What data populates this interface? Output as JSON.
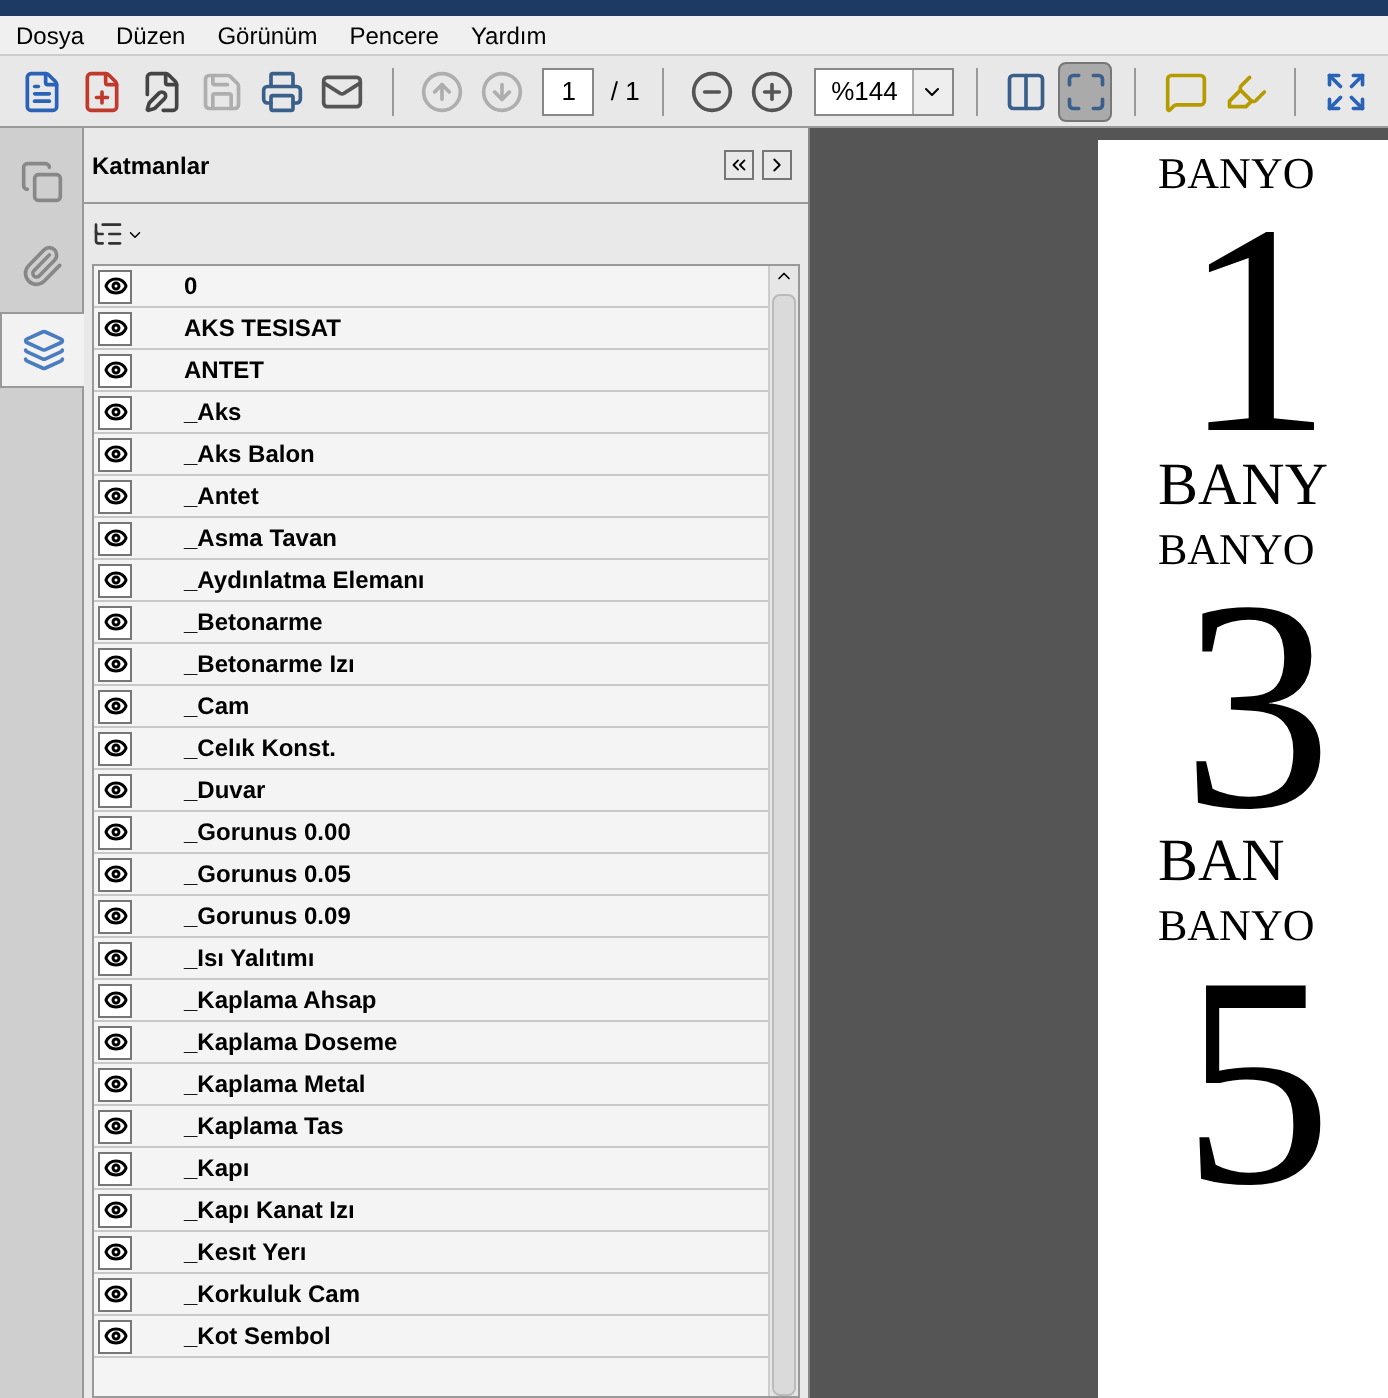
{
  "menu": [
    "Dosya",
    "Düzen",
    "Görünüm",
    "Pencere",
    "Yardım"
  ],
  "tools": [
    {
      "kind": "create",
      "disabled": false
    },
    {
      "kind": "new-doc",
      "disabled": false
    },
    {
      "kind": "sign",
      "disabled": false
    },
    {
      "kind": "save",
      "disabled": true
    },
    {
      "kind": "print",
      "disabled": false
    },
    {
      "kind": "mail",
      "disabled": false
    },
    {
      "kind": "sep"
    },
    {
      "kind": "prev",
      "disabled": true
    },
    {
      "kind": "next",
      "disabled": true
    },
    {
      "kind": "page"
    },
    {
      "kind": "sep"
    },
    {
      "kind": "zoom-out",
      "disabled": false
    },
    {
      "kind": "zoom-in",
      "disabled": false
    },
    {
      "kind": "zoom"
    },
    {
      "kind": "sep"
    },
    {
      "kind": "fit-width",
      "selected": false
    },
    {
      "kind": "fit-page",
      "selected": true
    },
    {
      "kind": "sep"
    },
    {
      "kind": "comment",
      "disabled": false
    },
    {
      "kind": "highlight",
      "disabled": false
    },
    {
      "kind": "sep"
    },
    {
      "kind": "expand",
      "disabled": false
    }
  ],
  "page": {
    "value": "1",
    "total": "/ 1"
  },
  "zoom": {
    "value": "%144"
  },
  "side_tabs": [
    {
      "kind": "pages",
      "selected": false
    },
    {
      "kind": "attachments",
      "selected": false
    },
    {
      "kind": "layers",
      "selected": true
    }
  ],
  "panel": {
    "title": "Katmanlar",
    "layers": [
      {
        "name": "0",
        "visible": true
      },
      {
        "name": "AKS TESISAT",
        "visible": true
      },
      {
        "name": "ANTET",
        "visible": true
      },
      {
        "name": "_Aks",
        "visible": true
      },
      {
        "name": "_Aks Balon",
        "visible": true
      },
      {
        "name": "_Antet",
        "visible": true
      },
      {
        "name": "_Asma Tavan",
        "visible": true
      },
      {
        "name": "_Aydınlatma Elemanı",
        "visible": true
      },
      {
        "name": "_Betonarme",
        "visible": true
      },
      {
        "name": "_Betonarme Izı",
        "visible": true
      },
      {
        "name": "_Cam",
        "visible": true
      },
      {
        "name": "_Celık Konst.",
        "visible": true
      },
      {
        "name": "_Duvar",
        "visible": true
      },
      {
        "name": "_Gorunus 0.00",
        "visible": true
      },
      {
        "name": "_Gorunus 0.05",
        "visible": true
      },
      {
        "name": "_Gorunus 0.09",
        "visible": true
      },
      {
        "name": "_Isı Yalıtımı",
        "visible": true
      },
      {
        "name": "_Kaplama Ahsap",
        "visible": true
      },
      {
        "name": "_Kaplama Doseme",
        "visible": true
      },
      {
        "name": "_Kaplama Metal",
        "visible": true
      },
      {
        "name": "_Kaplama Tas",
        "visible": true
      },
      {
        "name": "_Kapı",
        "visible": true
      },
      {
        "name": "_Kapı Kanat Izı",
        "visible": true
      },
      {
        "name": "_Kesıt Yerı",
        "visible": true
      },
      {
        "name": "_Korkuluk Cam",
        "visible": true
      },
      {
        "name": "_Kot Sembol",
        "visible": true
      }
    ]
  },
  "document": {
    "lines": [
      {
        "kind": "small",
        "text": "BANYO"
      },
      {
        "kind": "number",
        "text": "1"
      },
      {
        "kind": "large",
        "text": "BANY"
      },
      {
        "kind": "small",
        "text": "BANYO"
      },
      {
        "kind": "number",
        "text": "3"
      },
      {
        "kind": "large",
        "text": "BAN"
      },
      {
        "kind": "small",
        "text": "BANYO"
      },
      {
        "kind": "number",
        "text": "5"
      }
    ]
  }
}
